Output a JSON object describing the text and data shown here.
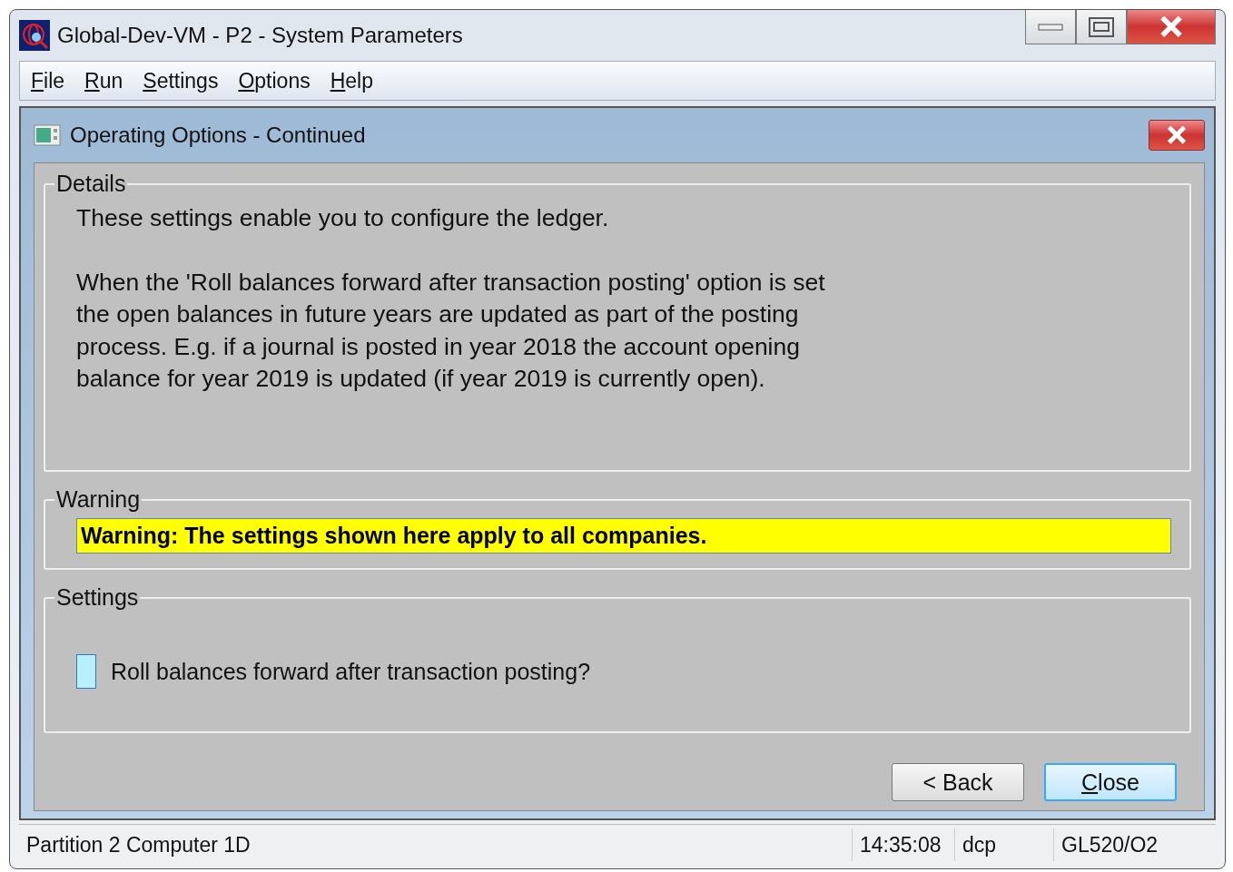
{
  "window": {
    "title": "Global-Dev-VM - P2 - System Parameters"
  },
  "menu": [
    "File",
    "Run",
    "Settings",
    "Options",
    "Help"
  ],
  "dialog": {
    "title": "Operating Options - Continued",
    "details": {
      "heading": "Details",
      "paragraphs": [
        "These settings enable you to configure the ledger.",
        "When the 'Roll balances forward after transaction posting' option is set the open balances in future years are updated as part of the posting process. E.g. if a journal is posted in year 2018 the account opening balance for year 2019 is updated (if year 2019 is currently open)."
      ]
    },
    "warning": {
      "heading": "Warning",
      "message": "Warning: The settings shown here apply to all companies."
    },
    "settings": {
      "heading": "Settings",
      "options": [
        {
          "label": "Roll balances forward after transaction posting?",
          "checked": false
        }
      ]
    },
    "buttons": [
      {
        "label": "< Back",
        "default": false
      },
      {
        "label": "Close",
        "default": true
      }
    ]
  },
  "status_bar": [
    "Partition 2 Computer 1D",
    "14:35:08",
    "dcp",
    "GL520/O2"
  ]
}
